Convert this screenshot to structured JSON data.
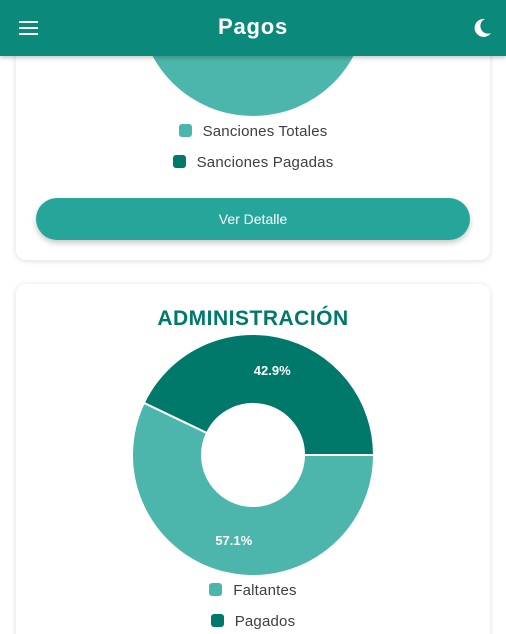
{
  "app": {
    "title": "Pagos"
  },
  "colors": {
    "appbar": "#0b8a7c",
    "light_teal": "#4db6ac",
    "dark_teal": "#00796b",
    "button": "#26a69a",
    "title_teal": "#00796b"
  },
  "icons": {
    "menu": "menu-icon",
    "theme": "moon-icon"
  },
  "sanctions_card": {
    "legend": [
      "Sanciones Totales",
      "Sanciones Pagadas"
    ],
    "button_label": "Ver Detalle"
  },
  "admin_card": {
    "title": "ADMINISTRACIÓN",
    "legend": [
      "Faltantes",
      "Pagados"
    ]
  },
  "chart_data": [
    {
      "type": "pie",
      "labels": [
        "Sanciones Totales",
        "Sanciones Pagadas"
      ],
      "values": [
        100,
        0
      ]
    },
    {
      "type": "pie",
      "title": "ADMINISTRACIÓN",
      "labels": [
        "Faltantes",
        "Pagados"
      ],
      "values": [
        57.1,
        42.9
      ],
      "value_labels": [
        "57.1%",
        "42.9%"
      ],
      "legend_position": "bottom"
    }
  ]
}
